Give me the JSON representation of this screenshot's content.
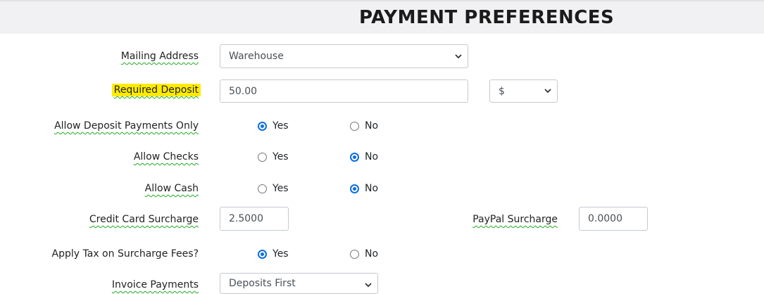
{
  "page": {
    "title": "PAYMENT PREFERENCES"
  },
  "fields": {
    "mailing_address": {
      "label": "Mailing Address",
      "value": "Warehouse"
    },
    "required_deposit": {
      "label": "Required Deposit",
      "value": "50.00",
      "unit": "$"
    },
    "allow_deposit_only": {
      "label": "Allow Deposit Payments Only",
      "yes": "Yes",
      "no": "No",
      "selected": "Yes"
    },
    "allow_checks": {
      "label": "Allow Checks",
      "yes": "Yes",
      "no": "No",
      "selected": "No"
    },
    "allow_cash": {
      "label": "Allow Cash",
      "yes": "Yes",
      "no": "No",
      "selected": "No"
    },
    "credit_card_surcharge": {
      "label": "Credit Card Surcharge",
      "value": "2.5000"
    },
    "paypal_surcharge": {
      "label": "PayPal Surcharge",
      "value": "0.0000"
    },
    "apply_tax_surcharge": {
      "label": "Apply Tax on Surcharge Fees?",
      "yes": "Yes",
      "no": "No",
      "selected": "Yes"
    },
    "invoice_payments": {
      "label": "Invoice Payments",
      "value": "Deposits First"
    }
  },
  "colors": {
    "accent": "#0b6fe0",
    "highlight": "#ffeb00",
    "header_bg": "#f1f1f3"
  }
}
